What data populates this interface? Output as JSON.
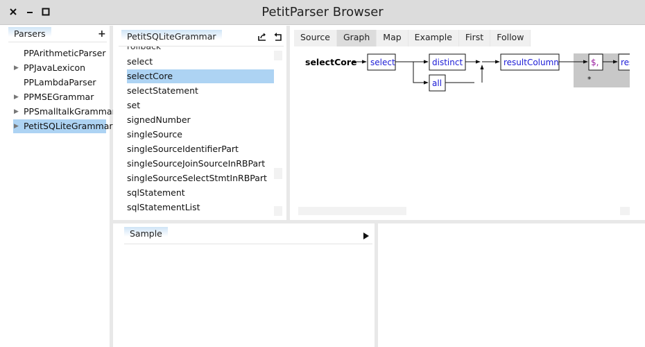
{
  "window": {
    "title": "PetitParser Browser"
  },
  "parsers_panel": {
    "tab_label": "Parsers",
    "add_label": "+",
    "items": [
      {
        "label": "PPArithmeticParser",
        "expandable": false
      },
      {
        "label": "PPJavaLexicon",
        "expandable": true
      },
      {
        "label": "PPLambdaParser",
        "expandable": false
      },
      {
        "label": "PPMSEGrammar",
        "expandable": true
      },
      {
        "label": "PPSmalltalkGrammar",
        "expandable": true
      },
      {
        "label": "PetitSQLiteGrammar",
        "expandable": true
      }
    ],
    "selected_index": 5
  },
  "rules_panel": {
    "tab_label": "PetitSQLiteGrammar",
    "partial_item": "rollback",
    "items": [
      "select",
      "selectCore",
      "selectStatement",
      "set",
      "signedNumber",
      "singleSource",
      "singleSourceIdentifierPart",
      "singleSourceJoinSourceInRBPart",
      "singleSourceSelectStmtInRBPart",
      "sqlStatement",
      "sqlStatementList"
    ],
    "selected_index": 1
  },
  "view_tabs": {
    "tabs": [
      "Source",
      "Graph",
      "Map",
      "Example",
      "First",
      "Follow"
    ],
    "active_index": 1
  },
  "graph": {
    "rule_name": "selectCore",
    "nodes": {
      "select": "select",
      "distinct": "distinct",
      "all": "all",
      "result_column": "resultColumn",
      "comma": "$,",
      "result_cut": "res"
    },
    "repeat_marker": "*"
  },
  "sample_panel": {
    "tab_label": "Sample",
    "play_icon": "play-icon"
  },
  "colors": {
    "selection": "#add3f3",
    "node_text": "#1a1ad6",
    "literal_text": "#9b1ea0",
    "repeat_bg": "#c8c8c8",
    "titlebar": "#dcdcdc"
  }
}
